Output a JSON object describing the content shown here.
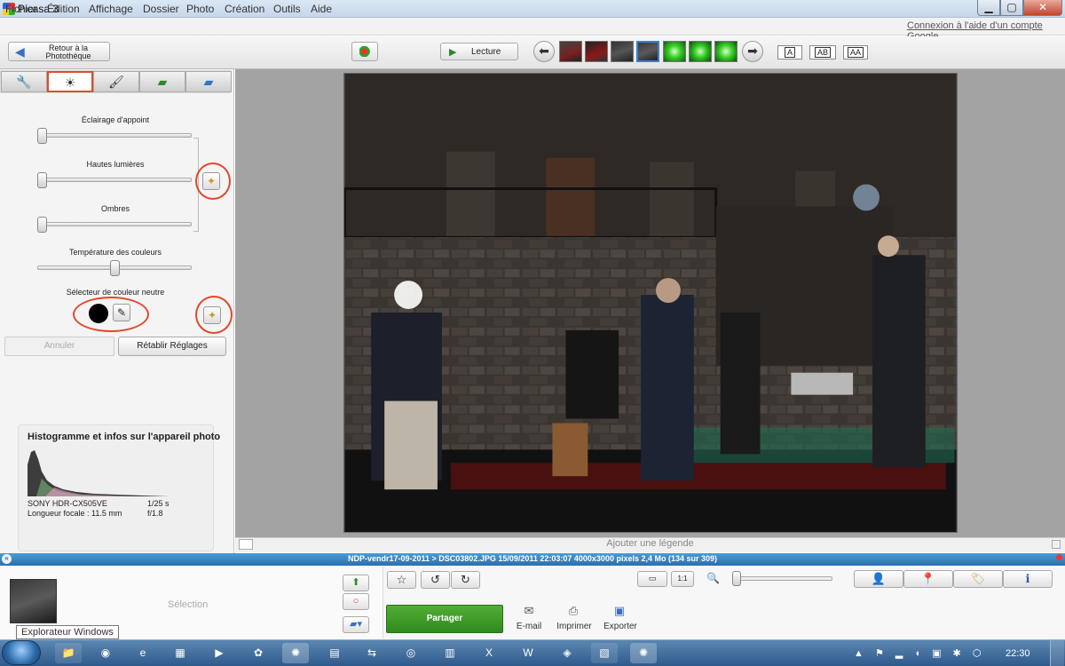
{
  "window": {
    "title": "Picasa 3",
    "controls": {
      "minimize": "▁",
      "maximize": "▢",
      "close": "✕"
    }
  },
  "menu": {
    "items": [
      "Fichier",
      "Édition",
      "Affichage",
      "Dossier",
      "Photo",
      "Création",
      "Outils",
      "Aide"
    ],
    "google_link": "Connexion à l'aide d'un compte Google"
  },
  "toolbar": {
    "back_label": "Retour à la Photothèque",
    "play_label": "Lecture",
    "layout_buttons": [
      "A",
      "AB",
      "AA"
    ],
    "filmstrip_count": 7
  },
  "tabs": [
    "wrench-icon",
    "tuning-icon",
    "brush-icon",
    "effects-icon",
    "effects-alt-icon"
  ],
  "sliders": {
    "fill_light": {
      "label": "Éclairage d'appoint",
      "value": 0
    },
    "highlights": {
      "label": "Hautes lumières",
      "value": 0
    },
    "shadows": {
      "label": "Ombres",
      "value": 0
    },
    "color_temp": {
      "label": "Température des couleurs",
      "value": 0.5
    }
  },
  "neutral": {
    "label": "Sélecteur de couleur neutre"
  },
  "actions": {
    "annuler": "Annuler",
    "retablir": "Rétablir Réglages"
  },
  "histogram": {
    "title": "Histogramme et infos sur l'appareil photo",
    "camera": "SONY HDR-CX505VE",
    "shutter": "1/25 s",
    "focal": "Longueur focale : 11.5 mm",
    "aperture": "f/1.8"
  },
  "caption": {
    "placeholder": "Ajouter une légende"
  },
  "status": {
    "text": "NDP-vendr17-09-2011 > DSC03802.JPG    15/09/2011 22:03:07    4000x3000 pixels    2,4 Mo    (134 sur 309)"
  },
  "tray": {
    "selection_label": "Sélection",
    "tooltip": "Explorateur Windows",
    "share": "Partager",
    "email": "E-mail",
    "print": "Imprimer",
    "export": "Exporter",
    "zoom_11": "1:1"
  },
  "taskbar": {
    "clock": "22:30"
  }
}
